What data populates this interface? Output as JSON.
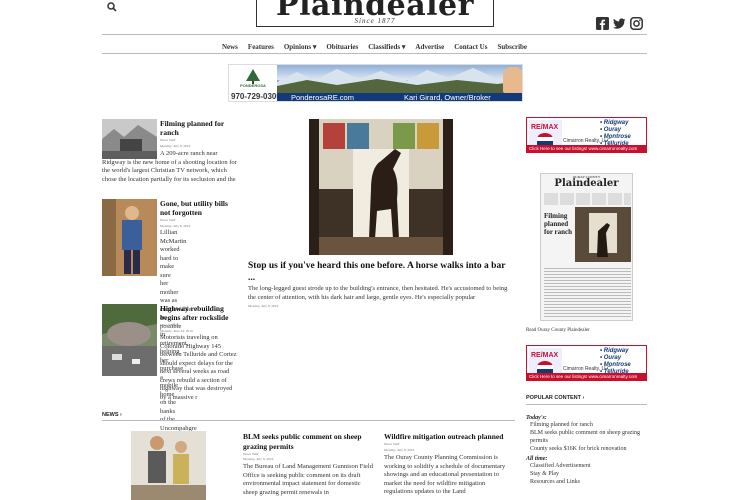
{
  "header": {
    "masthead_title": "Plaindealer",
    "masthead_since": "Since 1877"
  },
  "nav": {
    "items": [
      "News",
      "Features",
      "Opinions ▾",
      "Obituaries",
      "Classifieds ▾",
      "Advertise",
      "Contact Us",
      "Subscribe"
    ]
  },
  "banner_ad": {
    "brand": "PONDEROSA",
    "phone": "970-729-0300",
    "url": "PonderosaRE.com",
    "agent": "Kari Girard, Owner/Broker"
  },
  "stories": [
    {
      "title": "Filming planned for ranch",
      "author": "News Staff",
      "date": "Monday, July 8, 2019",
      "body": "A 209-acre ranch near Ridgway is the new home of a shooting location for the world's largest Christian TV network, which chose the location partially for its seclusion and the"
    },
    {
      "title": "Gone, but utility bills not forgotten",
      "author": "News Staff",
      "date": "Monday, July 8, 2019",
      "body": "Lillian McMartin worked hard to make sure her mother was as comfortable as possible in retirement, helping her purchase a mobile home on the banks of the Uncompahgre River to"
    },
    {
      "title": "Highway rebuilding begins after rockslide",
      "author": "Mike Wiggins",
      "date": "Monday, June 24, 2019",
      "body": "Motorists traveling on Colorado Highway 145 between Telluride and Cortez should expect delays for the next several weeks as road crews rebuild a section of highway that was destroyed by a massive r"
    }
  ],
  "feature": {
    "title": "Stop us if you've heard this one before. A horse walks into a bar ...",
    "body": "The long-legged guest strode up to the building's entrance, then hesitated. He's accustomed to being the center of attention, with his dark hair and large, gentle eyes. He's especially popular",
    "date": "Monday, July 8, 2019"
  },
  "sections": {
    "news": "NEWS ›",
    "popular": "POPULAR CONTENT ›"
  },
  "sidebar": {
    "remax": {
      "brand": "RE/MAX",
      "office": "Cimarron Realty, LLC",
      "towns": [
        "• Ridgway",
        "• Ouray",
        "• Montrose",
        "• Telluride"
      ],
      "cta": "Click Here to see our listings!  www.cimarronrealty.com"
    },
    "paper": {
      "label": "OURAY COUNTY",
      "name": "Plaindealer",
      "headline": "Filming planned for ranch",
      "caption": "Read Ouray County Plaindealer"
    },
    "popular": {
      "today_label": "Today's:",
      "today": [
        "Filming planned for ranch",
        "BLM seeks public comment on sheep grazing permits",
        "County seeks $16K for brick renovation"
      ],
      "alltime_label": "All time:",
      "alltime": [
        "Classified Advertisement",
        "Stay & Play",
        "Resources and Links"
      ]
    }
  },
  "bottom_news": [
    {
      "title": "BLM seeks public comment on sheep grazing permits",
      "author": "News Staff",
      "date": "Monday, July 8, 2019",
      "body": "The Bureau of Land Management Gunnison Field Office is seeking public comment on its draft environmental impact statement for domestic sheep grazing permit renewals in"
    },
    {
      "title": "Wildfire mitigation outreach planned",
      "author": "News Staff",
      "date": "Monday, July 8, 2019",
      "body": "The Ouray County Planning Commission is working to solidify a schedule of documentary showings and an educational presentation to market the need for wildfire mitigation regulations updates to the Land"
    }
  ],
  "colors": {
    "remax_red": "#c8102e",
    "remax_blue": "#123a7a"
  }
}
